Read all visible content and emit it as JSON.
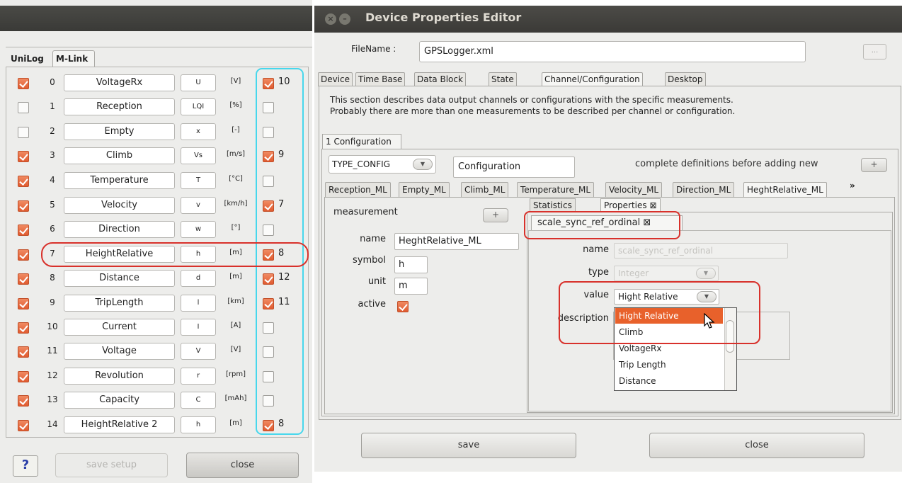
{
  "left_window": {
    "tabs": [
      "UniLog",
      "M-Link"
    ],
    "rows": [
      {
        "num": "0",
        "name": "VoltageRx",
        "symbol": "U",
        "unit": "[V]",
        "active": true,
        "channel": "10",
        "channel_on": true
      },
      {
        "num": "1",
        "name": "Reception",
        "symbol": "LQI",
        "unit": "[%]",
        "active": false,
        "channel": "",
        "channel_on": false
      },
      {
        "num": "2",
        "name": "Empty",
        "symbol": "x",
        "unit": "[-]",
        "active": false,
        "channel": "",
        "channel_on": false
      },
      {
        "num": "3",
        "name": "Climb",
        "symbol": "Vs",
        "unit": "[m/s]",
        "active": true,
        "channel": "9",
        "channel_on": true
      },
      {
        "num": "4",
        "name": "Temperature",
        "symbol": "T",
        "unit": "[°C]",
        "active": true,
        "channel": "",
        "channel_on": false
      },
      {
        "num": "5",
        "name": "Velocity",
        "symbol": "v",
        "unit": "[km/h]",
        "active": true,
        "channel": "7",
        "channel_on": true
      },
      {
        "num": "6",
        "name": "Direction",
        "symbol": "w",
        "unit": "[°]",
        "active": true,
        "channel": "",
        "channel_on": false
      },
      {
        "num": "7",
        "name": "HeightRelative",
        "symbol": "h",
        "unit": "[m]",
        "active": true,
        "channel": "8",
        "channel_on": true
      },
      {
        "num": "8",
        "name": "Distance",
        "symbol": "d",
        "unit": "[m]",
        "active": true,
        "channel": "12",
        "channel_on": true
      },
      {
        "num": "9",
        "name": "TripLength",
        "symbol": "l",
        "unit": "[km]",
        "active": true,
        "channel": "11",
        "channel_on": true
      },
      {
        "num": "10",
        "name": "Current",
        "symbol": "I",
        "unit": "[A]",
        "active": true,
        "channel": "",
        "channel_on": false
      },
      {
        "num": "11",
        "name": "Voltage",
        "symbol": "V",
        "unit": "[V]",
        "active": true,
        "channel": "",
        "channel_on": false
      },
      {
        "num": "12",
        "name": "Revolution",
        "symbol": "r",
        "unit": "[rpm]",
        "active": true,
        "channel": "",
        "channel_on": false
      },
      {
        "num": "13",
        "name": "Capacity",
        "symbol": "C",
        "unit": "[mAh]",
        "active": true,
        "channel": "",
        "channel_on": false
      },
      {
        "num": "14",
        "name": "HeightRelative 2",
        "symbol": "h",
        "unit": "[m]",
        "active": true,
        "channel": "8",
        "channel_on": true
      }
    ],
    "help_label": "?",
    "save_setup_label": "save setup",
    "close_label": "close"
  },
  "right_window": {
    "title": "Device Properties Editor",
    "filename_label": "FileName :",
    "filename_value": "GPSLogger.xml",
    "browse_label": "...",
    "main_tabs": [
      "Device",
      "Time Base",
      "Data Block",
      "State",
      "Channel/Configuration",
      "Desktop"
    ],
    "description_line1": "This section describes data output channels or configurations with the specific measurements.",
    "description_line2": "Probably there are more than one measurements to be described per channel or configuration.",
    "config_tab": "1 Configuration",
    "type_config": "TYPE_CONFIG",
    "configuration_value": "Configuration",
    "hint": "complete definitions before adding new",
    "add_label": "+",
    "channel_tabs": [
      "Reception_ML",
      "Empty_ML",
      "Climb_ML",
      "Temperature_ML",
      "Velocity_ML",
      "Direction_ML",
      "HeghtRelative_ML"
    ],
    "more_tabs": "»",
    "measurement": {
      "section_label": "measurement",
      "name_label": "name",
      "name_value": "HeghtRelative_ML",
      "symbol_label": "symbol",
      "symbol_value": "h",
      "unit_label": "unit",
      "unit_value": "m",
      "active_label": "active",
      "active": true
    },
    "sub_tabs": [
      "Statistics",
      "Properties"
    ],
    "property_tab": "scale_sync_ref_ordinal",
    "property": {
      "name_label": "name",
      "name_value": "scale_sync_ref_ordinal",
      "type_label": "type",
      "type_value": "Integer",
      "value_label": "value",
      "value_selected": "Hight Relative",
      "description_label": "description"
    },
    "dropdown_options": [
      "Hight Relative",
      "Climb",
      "VoltageRx",
      "Trip Length",
      "Distance"
    ],
    "save_label": "save",
    "close_label": "close"
  },
  "colors": {
    "accent": "#e8612b",
    "highlight_red": "#d8312b",
    "highlight_cyan": "#47d7ec"
  }
}
